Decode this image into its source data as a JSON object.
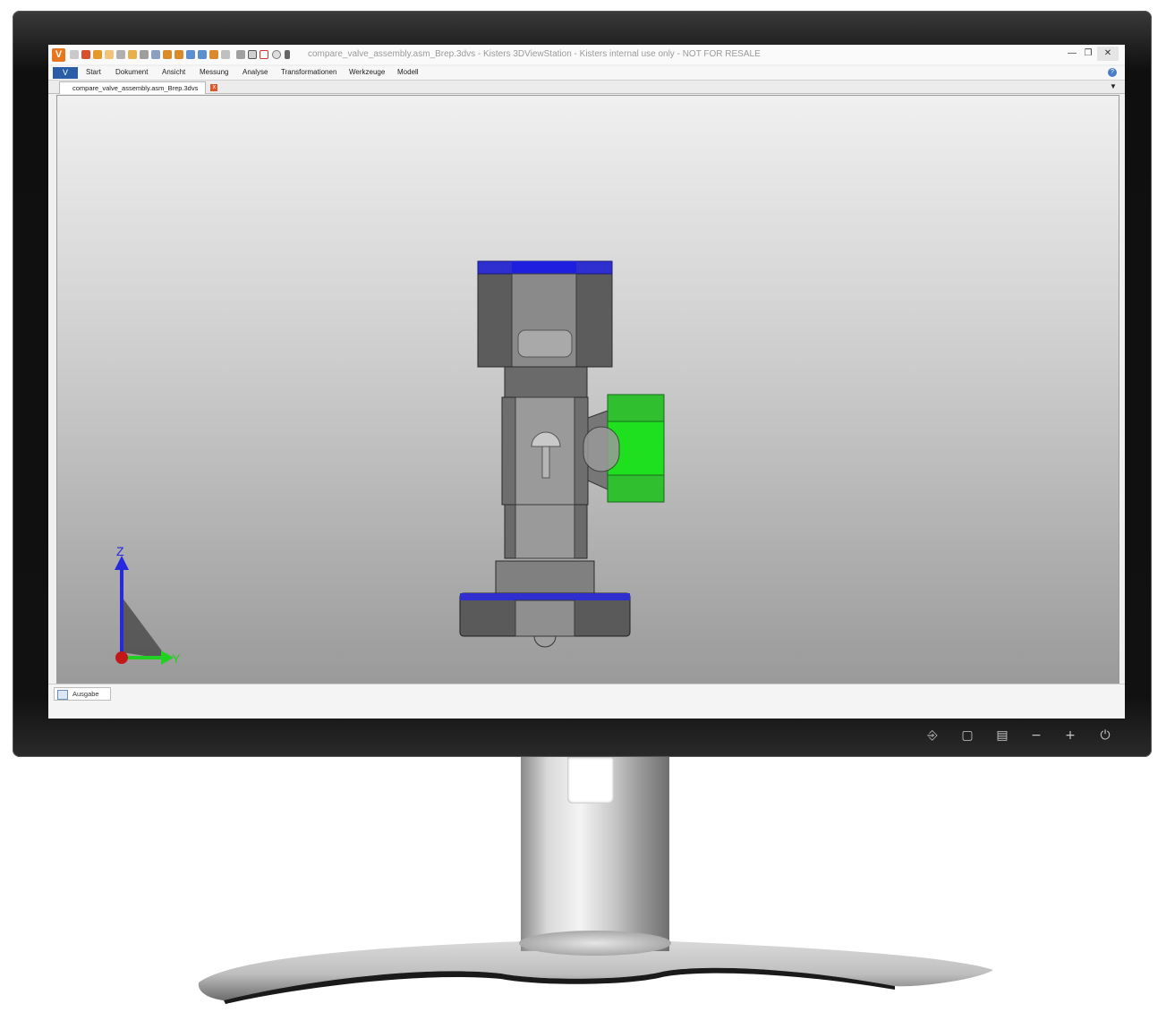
{
  "window": {
    "title": "compare_valve_assembly.asm_Brep.3dvs - Kisters 3DViewStation - Kisters internal use only - NOT FOR RESALE",
    "app_logo": "V",
    "minimize_icon": "minimize-icon",
    "restore_icon": "restore-icon",
    "close_icon": "close-icon"
  },
  "ribbon": {
    "file_label": "V",
    "menu": [
      "Start",
      "Dokument",
      "Ansicht",
      "Messung",
      "Analyse",
      "Transformationen",
      "Werkzeuge",
      "Modell"
    ],
    "help_icon": "help-icon",
    "help_label": "?"
  },
  "tabs": {
    "document_tab": "compare_valve_assembly.asm_Brep.3dvs",
    "close_label": "x",
    "dropdown_label": "▼"
  },
  "viewport": {
    "axis_z": "Z",
    "axis_y": "Y"
  },
  "output": {
    "tab_label": "Ausgabe"
  },
  "monitor_controls": {
    "icons": [
      "input-icon",
      "menu-icon",
      "settings-icon",
      "minus-icon",
      "plus-icon",
      "power-icon"
    ],
    "glyphs": [
      "⎆",
      "▢",
      "▤",
      "−",
      "+",
      "⏻"
    ]
  },
  "colors": {
    "accent": "#2a5ca8",
    "logo": "#e8761f",
    "highlight_green": "#2ecc2e",
    "highlight_blue": "#2a2ad0"
  }
}
